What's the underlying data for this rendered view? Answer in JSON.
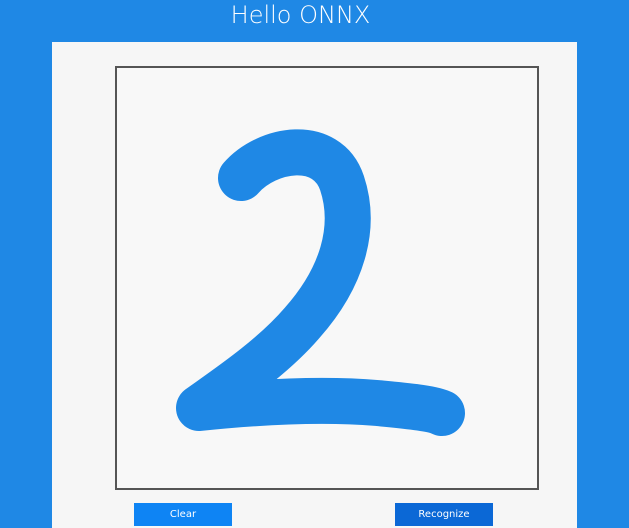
{
  "app": {
    "title": "Hello ONNX"
  },
  "canvas": {
    "ink_color": "#1f88e5",
    "drawn_content": "handwritten digit 2"
  },
  "buttons": {
    "clear_label": "Clear",
    "recognize_label": "Recognize"
  },
  "colors": {
    "background": "#1f88e5",
    "panel": "#f6f6f6",
    "clear_button": "#0e84f4",
    "recognize_button": "#0b68d6"
  }
}
